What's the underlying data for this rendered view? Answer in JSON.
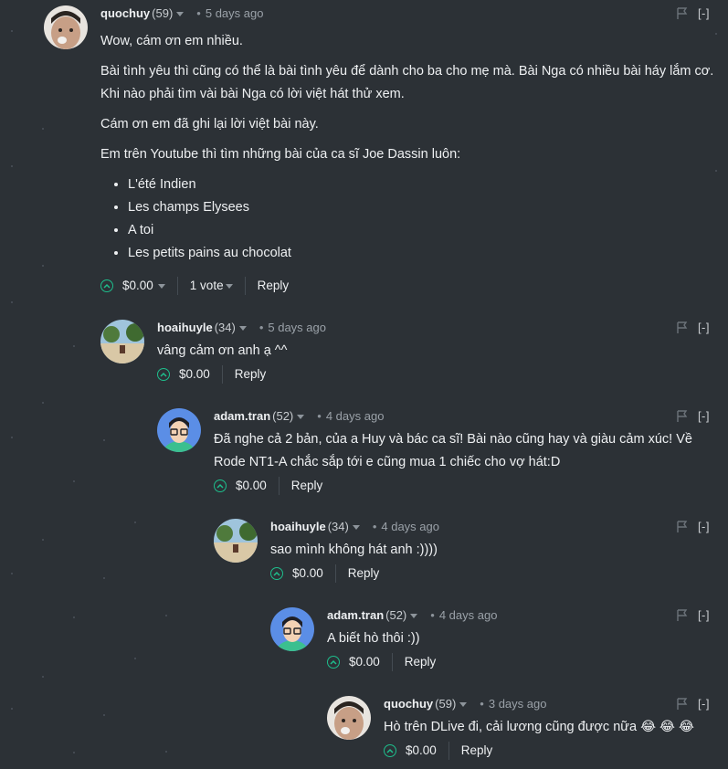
{
  "common": {
    "reply_label": "Reply",
    "collapse_label": "[-]",
    "bullet_sep": "•"
  },
  "colors": {
    "background": "#2c3136",
    "upvote": "#1ebe8c"
  },
  "comments": [
    {
      "author": "quochuy",
      "reputation": "(59)",
      "time": "5 days ago",
      "payout": "$0.00",
      "votes": "1 vote",
      "paragraphs": [
        "Wow, cám ơn em nhiều.",
        "Bài tình yêu thì cũng có thể là bài tình yêu để dành cho ba cho mẹ mà. Bài Nga có nhiều bài háy lắm cơ. Khi nào phải tìm vài bài Nga có lời việt hát thử xem.",
        "Cám ơn em đã ghi lại lời việt bài này.",
        "Em trên Youtube thì tìm những bài của ca sĩ Joe Dassin luôn:"
      ],
      "list": [
        "L'été Indien",
        "Les champs Elysees",
        "A toi",
        "Les petits pains au chocolat"
      ]
    },
    {
      "author": "hoaihuyle",
      "reputation": "(34)",
      "time": "5 days ago",
      "payout": "$0.00",
      "paragraphs": [
        "vâng cảm ơn anh ạ ^^"
      ]
    },
    {
      "author": "adam.tran",
      "reputation": "(52)",
      "time": "4 days ago",
      "payout": "$0.00",
      "paragraphs": [
        "Đã nghe cả 2 bản, của a Huy và bác ca sĩ! Bài nào cũng hay và giàu cảm xúc! Về Rode NT1-A chắc sắp tới e cũng mua 1 chiếc cho vợ hát:D"
      ]
    },
    {
      "author": "hoaihuyle",
      "reputation": "(34)",
      "time": "4 days ago",
      "payout": "$0.00",
      "paragraphs": [
        "sao mình không hát anh :))))"
      ]
    },
    {
      "author": "adam.tran",
      "reputation": "(52)",
      "time": "4 days ago",
      "payout": "$0.00",
      "paragraphs": [
        "A biết hò thôi :))"
      ]
    },
    {
      "author": "quochuy",
      "reputation": "(59)",
      "time": "3 days ago",
      "payout": "$0.00",
      "paragraphs": [
        "Hò trên DLive đi, cải lương cũng được nữa 😂 😂 😂"
      ]
    }
  ]
}
